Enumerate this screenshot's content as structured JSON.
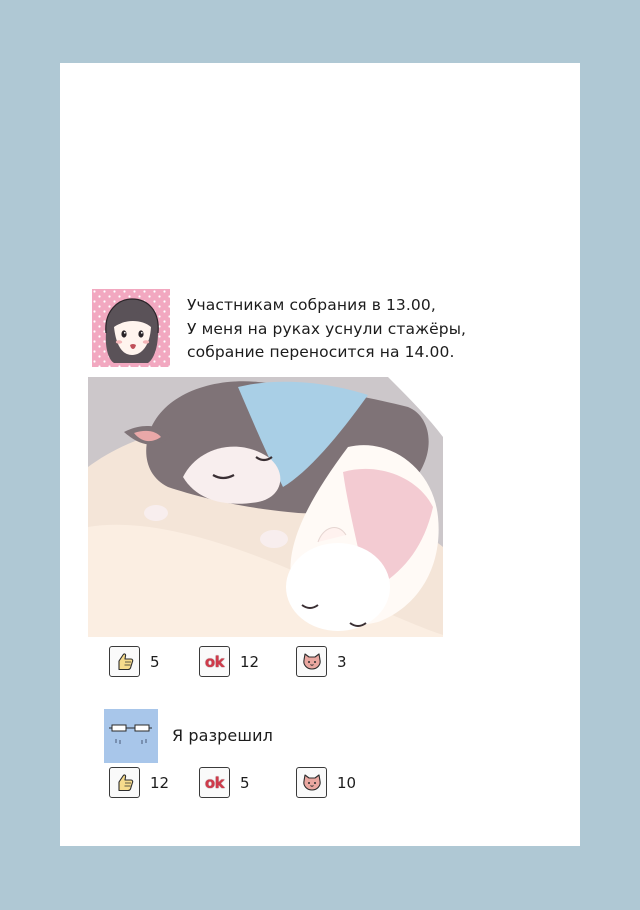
{
  "messages": [
    {
      "author_avatar": "girl-avatar",
      "lines": [
        "Участникам собрания в 13.00,",
        "У меня на руках уснули стажёры,",
        "собрание переносится на 14.00."
      ],
      "reactions": [
        {
          "icon": "thumbs-up-icon",
          "count": "5"
        },
        {
          "icon": "ok-icon",
          "label": "ok",
          "count": "12"
        },
        {
          "icon": "cat-face-icon",
          "count": "3"
        }
      ]
    },
    {
      "author_avatar": "boss-avatar",
      "text": "Я разрешил",
      "reactions": [
        {
          "icon": "thumbs-up-icon",
          "count": "12"
        },
        {
          "icon": "ok-icon",
          "label": "ok",
          "count": "5"
        },
        {
          "icon": "cat-face-icon",
          "count": "10"
        }
      ]
    }
  ],
  "colors": {
    "frame": "#afc8d4",
    "avatar_girl_bg": "#f2a8c0",
    "avatar_boss_bg": "#a8c6ea",
    "ok_red": "#d03a4a",
    "cat_pink": "#eaa7a0",
    "thumb_yellow": "#f6db8c"
  }
}
